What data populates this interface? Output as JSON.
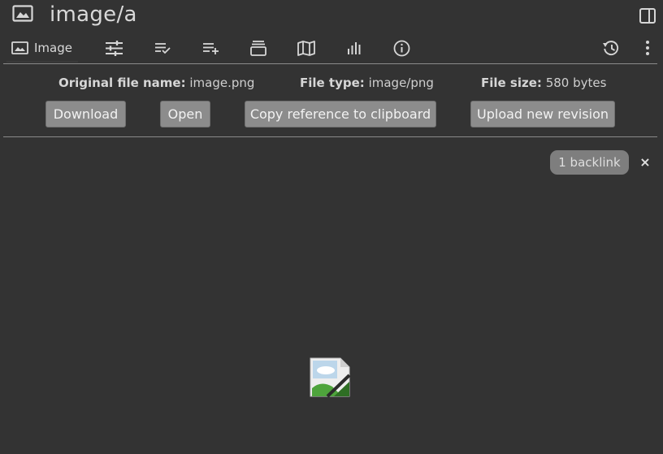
{
  "window": {
    "title": "image/a"
  },
  "tabs": {
    "image_label": "Image",
    "items": [
      {
        "name": "tab-image",
        "icon": "image-icon"
      },
      {
        "name": "tab-settings",
        "icon": "sliders-icon"
      },
      {
        "name": "tab-edit",
        "icon": "list-check-icon"
      },
      {
        "name": "tab-add",
        "icon": "list-add-icon"
      },
      {
        "name": "tab-layers",
        "icon": "stack-icon"
      },
      {
        "name": "tab-map",
        "icon": "map-icon"
      },
      {
        "name": "tab-stats",
        "icon": "bars-icon"
      },
      {
        "name": "tab-info",
        "icon": "info-icon"
      },
      {
        "name": "tab-history",
        "icon": "history-icon"
      },
      {
        "name": "tab-more",
        "icon": "more-vertical-icon"
      }
    ]
  },
  "file_info": {
    "original_name_label": "Original file name:",
    "original_name_value": "image.png",
    "type_label": "File type:",
    "type_value": "image/png",
    "size_label": "File size:",
    "size_value": "580 bytes"
  },
  "actions": {
    "download": "Download",
    "open": "Open",
    "copy_reference": "Copy reference to clipboard",
    "upload_revision": "Upload new revision"
  },
  "backlinks": {
    "label": "1 backlink",
    "close": "×"
  },
  "colors": {
    "background": "#333333",
    "button": "#8c8c8c",
    "pill": "#7e7e7e",
    "text": "#d6d6d6"
  }
}
